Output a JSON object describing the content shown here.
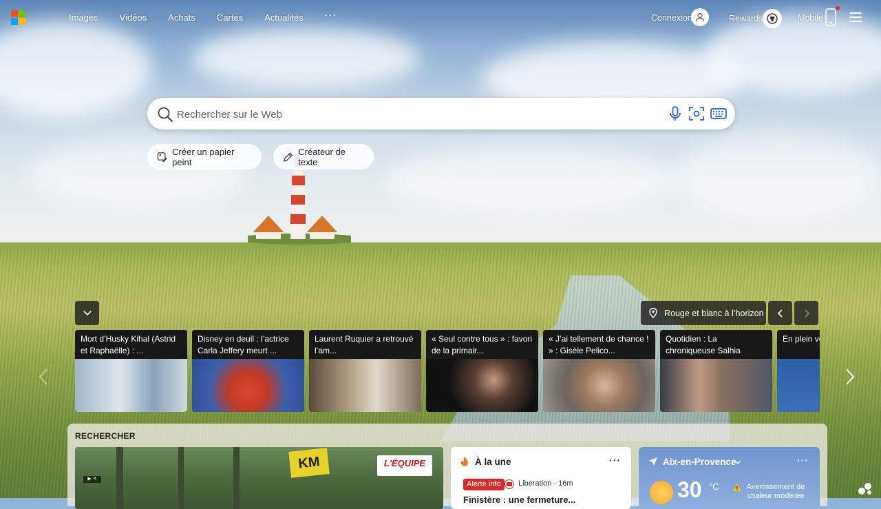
{
  "header": {
    "nav": [
      "Images",
      "Vidéos",
      "Achats",
      "Cartes",
      "Actualités"
    ],
    "more": "···",
    "signin": "Connexion",
    "rewards": "Rewards",
    "mobile": "Mobile"
  },
  "search": {
    "placeholder": "Rechercher sur le Web"
  },
  "chips": {
    "wallpaper": "Créer un papier peint",
    "text_creator": "Créateur de texte"
  },
  "image_info": {
    "location": "Rouge et blanc à l’horizon"
  },
  "news": [
    {
      "title": "Mort d’Husky Kihal (Astrid et Raphaëlle) : ..."
    },
    {
      "title": "Disney en deuil : l’actrice Carla Jeffery meurt ..."
    },
    {
      "title": "Laurent Ruquier a retrouvé l’am..."
    },
    {
      "title": "« Seul contre tous » : favori de la primair..."
    },
    {
      "title": "« J’ai tellement de chance ! » : Gisèle Pelico..."
    },
    {
      "title": "Quotidien : La chroniqueuse Salhia Brakhli..."
    },
    {
      "title": "En plein vo... l’Atlantique..."
    }
  ],
  "panel": {
    "label": "RECHERCHER",
    "video": {
      "logo": "L'ÉQUIPE",
      "sign": "KM",
      "badge": "▶ ✕"
    },
    "top_story": {
      "title": "À la une",
      "more": "···",
      "badge": "Alerte info",
      "source": "Liberation · 16m",
      "headline": "Finistère : une fermeture..."
    },
    "weather": {
      "city": "Aix-en-Provence",
      "more": "···",
      "temperature": "30",
      "unit": "°C",
      "warning": "Avertissement de chaleur modérée"
    }
  },
  "colors": {
    "logo": [
      "#f25022",
      "#7fba00",
      "#00a4ef",
      "#ffb900"
    ],
    "alert": "#d92a2a",
    "accent": "#2b5fd9"
  },
  "icons": {
    "search": "search-icon",
    "mic": "microphone-icon",
    "visual": "visual-search-icon",
    "keyboard": "keyboard-icon"
  }
}
